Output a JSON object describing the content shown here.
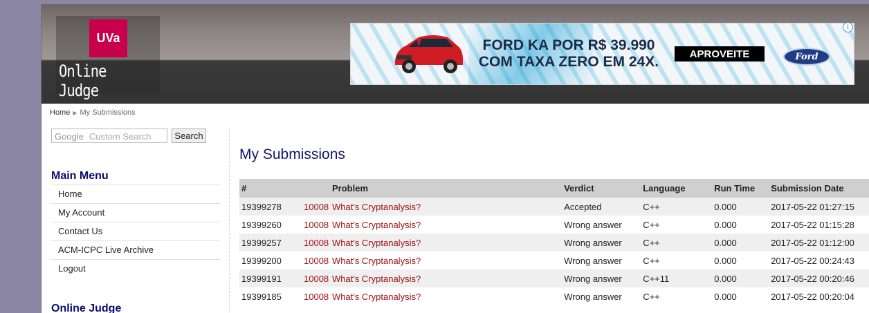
{
  "header": {
    "logo_text": "UVa",
    "site_title": "Online Judge"
  },
  "ad": {
    "headline_line1": "FORD KA POR R$ 39.990",
    "headline_line2": "COM TAXA ZERO EM 24X.",
    "cta": "APROVEITE",
    "brand": "Ford",
    "info_icon": "i"
  },
  "breadcrumb": {
    "home": "Home",
    "current": "My Submissions"
  },
  "search": {
    "brand": "Google",
    "placeholder": "Custom Search",
    "button": "Search"
  },
  "sidebar": {
    "main_menu_title": "Main Menu",
    "items": [
      "Home",
      "My Account",
      "Contact Us",
      "ACM-ICPC Live Archive",
      "Logout"
    ],
    "second_title": "Online Judge"
  },
  "main": {
    "title": "My Submissions",
    "columns": [
      "#",
      "Problem",
      "Verdict",
      "Language",
      "Run Time",
      "Submission Date"
    ],
    "rows": [
      {
        "id": "19399278",
        "pid": "10008",
        "problem": "What's Cryptanalysis?",
        "verdict": "Accepted",
        "language": "C++",
        "runtime": "0.000",
        "date": "2017-05-22 01:27:15"
      },
      {
        "id": "19399260",
        "pid": "10008",
        "problem": "What's Cryptanalysis?",
        "verdict": "Wrong answer",
        "language": "C++",
        "runtime": "0.000",
        "date": "2017-05-22 01:15:28"
      },
      {
        "id": "19399257",
        "pid": "10008",
        "problem": "What's Cryptanalysis?",
        "verdict": "Wrong answer",
        "language": "C++",
        "runtime": "0.000",
        "date": "2017-05-22 01:12:00"
      },
      {
        "id": "19399200",
        "pid": "10008",
        "problem": "What's Cryptanalysis?",
        "verdict": "Wrong answer",
        "language": "C++",
        "runtime": "0.000",
        "date": "2017-05-22 00:24:43"
      },
      {
        "id": "19399191",
        "pid": "10008",
        "problem": "What's Cryptanalysis?",
        "verdict": "Wrong answer",
        "language": "C++11",
        "runtime": "0.000",
        "date": "2017-05-22 00:20:46"
      },
      {
        "id": "19399185",
        "pid": "10008",
        "problem": "What's Cryptanalysis?",
        "verdict": "Wrong answer",
        "language": "C++",
        "runtime": "0.000",
        "date": "2017-05-22 00:20:04"
      }
    ]
  },
  "colors": {
    "brand_red": "#c8004b",
    "heading_navy": "#14146e",
    "link_red": "#a01010"
  }
}
